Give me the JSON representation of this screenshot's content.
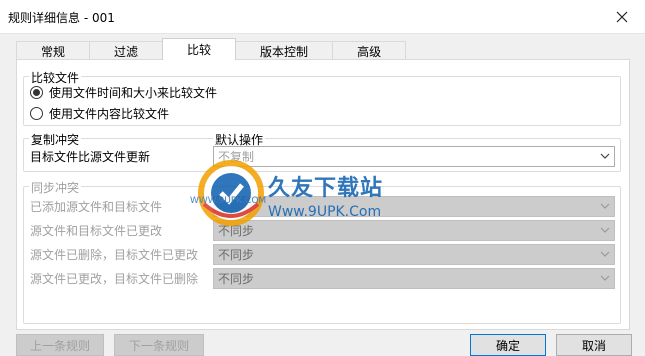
{
  "window": {
    "title": "规则详细信息 - 001"
  },
  "tabs": [
    {
      "label": "常规"
    },
    {
      "label": "过滤"
    },
    {
      "label": "比较",
      "active": true
    },
    {
      "label": "版本控制"
    },
    {
      "label": "高级"
    }
  ],
  "compare_files": {
    "legend": "比较文件",
    "options": [
      {
        "label": "使用文件时间和大小来比较文件",
        "selected": true
      },
      {
        "label": "使用文件内容比较文件",
        "selected": false
      }
    ]
  },
  "copy_conflict": {
    "legend": "复制冲突",
    "column_header": "默认操作",
    "row_label": "目标文件比源文件更新",
    "value": "不复制"
  },
  "sync_conflict": {
    "legend": "同步冲突",
    "rows": [
      {
        "label": "已添加源文件和目标文件",
        "value": ""
      },
      {
        "label": "源文件和目标文件已更改",
        "value": "不同步"
      },
      {
        "label": "源文件已删除，目标文件已更改",
        "value": "不同步"
      },
      {
        "label": "源文件已更改，目标文件已删除",
        "value": "不同步"
      }
    ]
  },
  "buttons": {
    "prev_rule": "上一条规则",
    "next_rule": "下一条规则",
    "ok": "确定",
    "cancel": "取消"
  },
  "watermark": {
    "title": "久友下载站",
    "url": "Www.9UPK.Com",
    "side_text": "WWW.9UPK.COM"
  },
  "colors": {
    "dialog_bg": "#f0f0f0",
    "panel_bg": "#ffffff",
    "disabled_text": "#a0a0a0",
    "disabled_combo": "#cccccc",
    "default_button_border": "#0078d7"
  }
}
